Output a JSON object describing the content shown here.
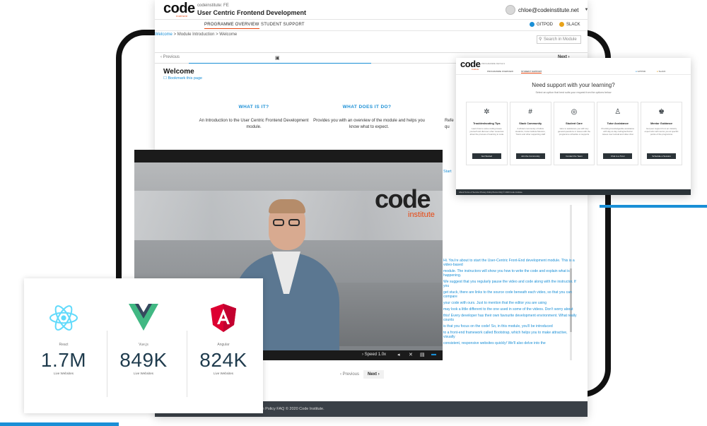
{
  "lms": {
    "small_title": "codeinstitute: FE",
    "course_title": "User Centric Frontend Development",
    "user_email": "chloe@codeinstitute.net",
    "nav": {
      "programme_overview": "PROGRAMME OVERVIEW",
      "student_support": "STUDENT SUPPORT",
      "gitpod": "GITPOD",
      "slack": "SLACK"
    },
    "breadcrumb": {
      "welcome": "Welcome",
      "sep": " > ",
      "module_intro": "Module Introduction",
      "current": "Welcome"
    },
    "search_placeholder": "Search in Module",
    "prev_label": "Previous",
    "next_label": "Next",
    "page_title": "Welcome",
    "bookmark": "Bookmark this page",
    "columns": [
      {
        "heading": "WHAT IS IT?",
        "text": "An Introduction to the User Centric Frontend Development module."
      },
      {
        "heading": "WHAT DOES IT DO?",
        "text": "Provides you with an overview of the module and helps you know what to expect."
      },
      {
        "text": "Refe"
      },
      {
        "text": "qu"
      }
    ],
    "start_line": "Start",
    "transcript": [
      "Hi. You're about to start the User-Centric Front-End development module. This is a video-based",
      "module. The instructors will show you how to write the code and explain what is happening.",
      "We suggest that you regularly pause the video and code along with the instructor. If you",
      "get stuck, there are links to the source code beneath each video, so that you can compare",
      "your code with ours. Just to mention that the editor you are using",
      "may look a little different to the one used in some of the videos. Don't worry about",
      "this! Every developer has their own favourite development environment. What really counts",
      "is that you focus on the code! So, in this module, you'll be introduced",
      "to a front-end framework called Bootstrap, which helps you to make attractive, visually",
      "consistent, responsive websites quickly! We'll also delve into the"
    ],
    "pager_prev": "Previous",
    "pager_next": "Next",
    "footer": "m Policy   FAQ   © 2020 Code Institute."
  },
  "brand": {
    "logo": "code",
    "logo_sub": "institute"
  },
  "video": {
    "speed": "Speed  1.0x"
  },
  "support": {
    "programme_label": "PROGRAMME DETAILS",
    "tab_overview": "PROGRAMME OVERVIEW",
    "tab_support": "STUDENT SUPPORT",
    "gitpod": "GITPOD",
    "slack": "SLACK",
    "headline": "Need support with your learning?",
    "subline": "Select an option that best suits your request from the options below",
    "cards": [
      {
        "icon": "bug-icon",
        "title": "Troubleshooting Tips",
        "desc": "Learn how to solve coding issues yourself and discover other resources about the process of learning to code",
        "button": "Get Started"
      },
      {
        "icon": "slack-icon",
        "title": "Slack Community",
        "desc": "A vibrant community of fellow students, Code Institute Mentors, Tutors and other supporting staff",
        "button": "Join the Community"
      },
      {
        "icon": "headset-icon",
        "title": "Student Care",
        "desc": "Here to assistance you with any general questions or issues with the programme schedule or supports",
        "button": "Contact the Team"
      },
      {
        "icon": "tutor-icon",
        "title": "Tutor Assistance",
        "desc": "Providing knowledgeable assistance with day-to-day coding/technical issues over textual and video chat",
        "button": "Chat to a Tutor"
      },
      {
        "icon": "mentor-icon",
        "title": "Mentor Guidance",
        "desc": "Get peer support from an industry expert who will mentor you at specific points of the programme",
        "button": "Schedule a Session"
      }
    ],
    "footer": "About   Terms of Service   Privacy   Policy/Terms   FAQ   © 2020 Code Institute"
  },
  "stats": [
    {
      "framework": "React",
      "value": "1.7M",
      "label": "Live Websites",
      "color": "#61dafb"
    },
    {
      "framework": "Vue.js",
      "value": "849K",
      "label": "Live Websites",
      "color": "#41b883"
    },
    {
      "framework": "Angular",
      "value": "824K",
      "label": "Live Websites",
      "color": "#dd0031"
    }
  ],
  "colors": {
    "accent": "#1a8fd6",
    "brand_orange": "#e84610",
    "dark": "#2b3338"
  }
}
